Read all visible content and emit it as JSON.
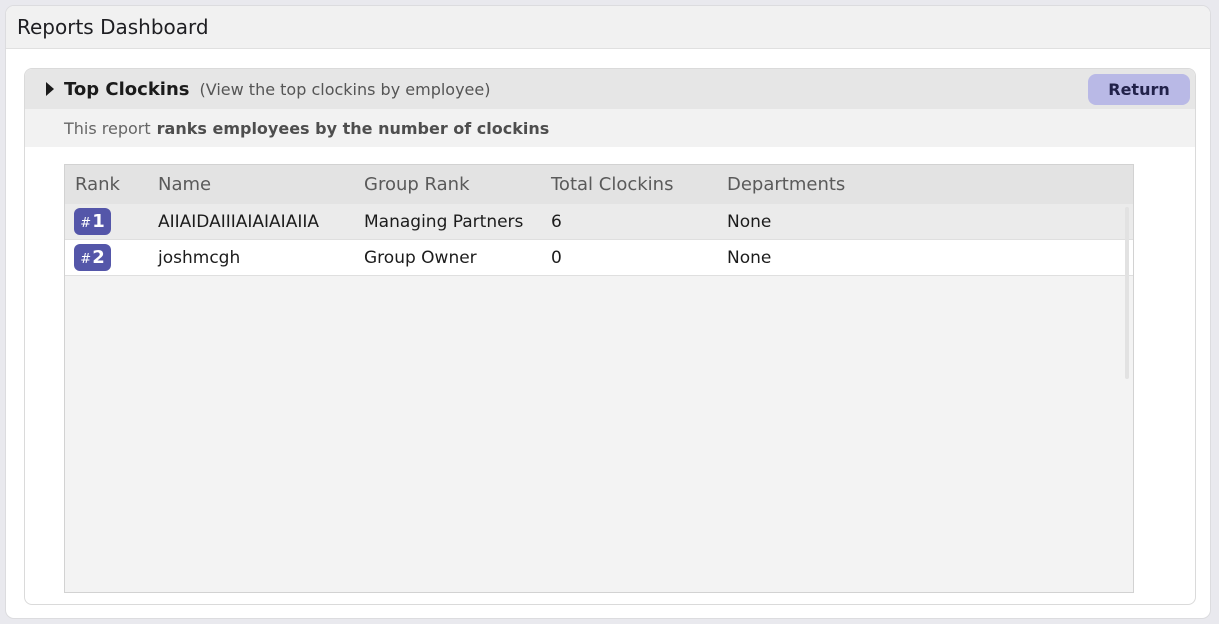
{
  "window": {
    "title": "Reports Dashboard"
  },
  "report": {
    "title": "Top Clockins",
    "subtitle": "(View the top clockins by employee)",
    "return_label": "Return",
    "desc_prefix": "This report",
    "desc_bold": "ranks employees by the number of clockins"
  },
  "table": {
    "headers": {
      "rank": "Rank",
      "name": "Name",
      "group_rank": "Group Rank",
      "total_clockins": "Total Clockins",
      "departments": "Departments"
    },
    "rows": [
      {
        "hash": "#",
        "rank": "1",
        "name": "AIIAIDAIIIAIAIAIAIIA",
        "group_rank": "Managing Partners",
        "total_clockins": "6",
        "departments": "None"
      },
      {
        "hash": "#",
        "rank": "2",
        "name": "joshmcgh",
        "group_rank": "Group Owner",
        "total_clockins": "0",
        "departments": "None"
      }
    ]
  },
  "colors": {
    "accent_badge": "#5456a9",
    "return_button": "#b9b9e6"
  }
}
